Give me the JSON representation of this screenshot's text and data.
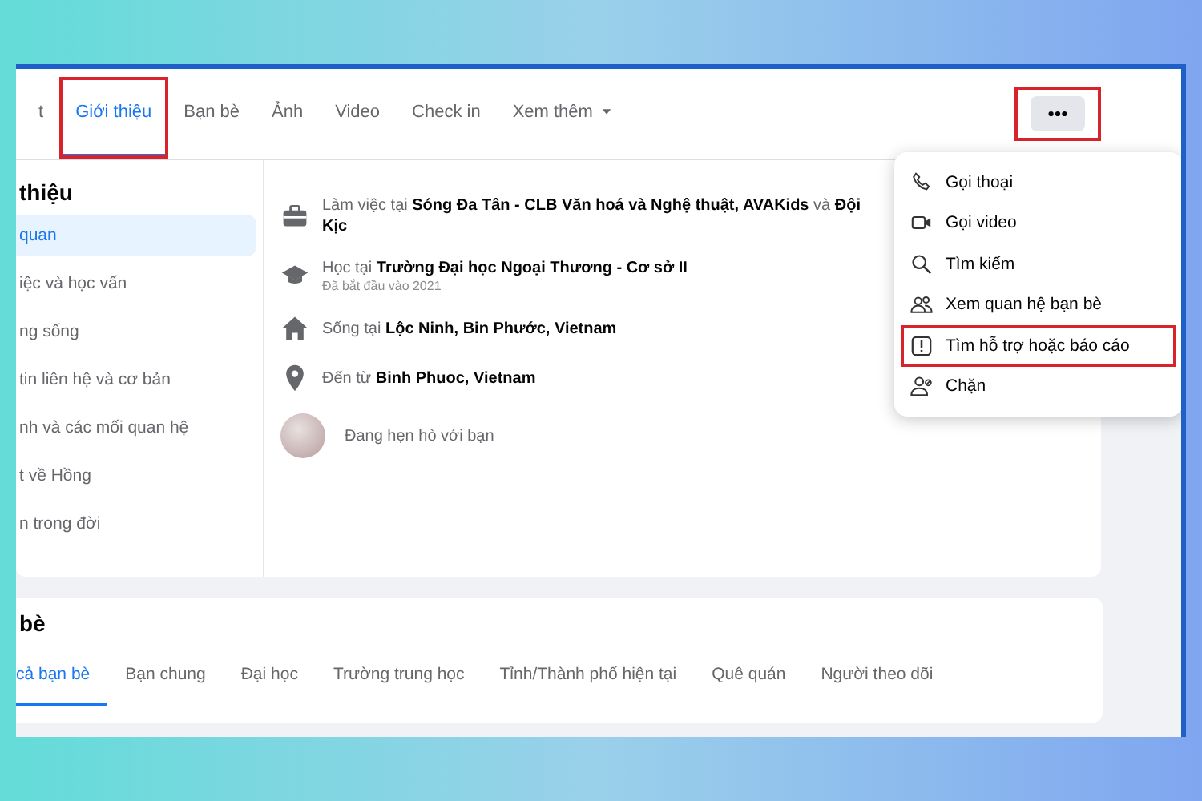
{
  "profile_tabs": [
    {
      "label": "t",
      "selected": false,
      "highlighted": false
    },
    {
      "label": "Giới thiệu",
      "selected": true,
      "highlighted": true
    },
    {
      "label": "Bạn bè",
      "selected": false,
      "highlighted": false
    },
    {
      "label": "Ảnh",
      "selected": false,
      "highlighted": false
    },
    {
      "label": "Video",
      "selected": false,
      "highlighted": false
    },
    {
      "label": "Check in",
      "selected": false,
      "highlighted": false
    },
    {
      "label": "Xem thêm",
      "selected": false,
      "highlighted": false,
      "dropdown": true
    }
  ],
  "more_button": {
    "highlighted": true
  },
  "about_sidebar": {
    "title": "thiệu",
    "items": [
      {
        "label": "quan",
        "selected": true
      },
      {
        "label": "iệc và học vấn",
        "selected": false
      },
      {
        "label": "ng sống",
        "selected": false
      },
      {
        "label": "tin liên hệ và cơ bản",
        "selected": false
      },
      {
        "label": "nh và các mối quan hệ",
        "selected": false
      },
      {
        "label": "t về Hồng",
        "selected": false
      },
      {
        "label": "n trong đời",
        "selected": false
      }
    ]
  },
  "about_details": [
    {
      "kind": "work",
      "text": "Làm việc tại **Sóng Đa Tân - CLB Văn hoá và Nghệ thuật, AVAKids** và **Đội Kịc**"
    },
    {
      "kind": "school",
      "text": "Học tại **Trường Đại học Ngoại Thương - Cơ sở II**",
      "note": "Đã bắt đầu vào 2021"
    },
    {
      "kind": "home",
      "text": "Sống tại **Lộc Ninh, Bin Phước, Vietnam**"
    },
    {
      "kind": "place",
      "text": "Đến từ **Binh Phuoc, Vietnam**"
    },
    {
      "kind": "relationship",
      "text": "Đang hẹn hò với bạn"
    }
  ],
  "more_menu": [
    {
      "kind": "call",
      "label": "Gọi thoại",
      "highlighted": false
    },
    {
      "kind": "video",
      "label": "Gọi video",
      "highlighted": false
    },
    {
      "kind": "search",
      "label": "Tìm kiếm",
      "highlighted": false
    },
    {
      "kind": "friends",
      "label": "Xem quan hệ bạn bè",
      "highlighted": false
    },
    {
      "kind": "report",
      "label": "Tìm hỗ trợ hoặc báo cáo",
      "highlighted": true
    },
    {
      "kind": "block",
      "label": "Chặn",
      "highlighted": false
    }
  ],
  "friends_section": {
    "title": "bè",
    "tabs": [
      {
        "label": "cả bạn bè",
        "selected": true
      },
      {
        "label": "Bạn chung",
        "selected": false
      },
      {
        "label": "Đại học",
        "selected": false
      },
      {
        "label": "Trường trung học",
        "selected": false
      },
      {
        "label": "Tỉnh/Thành phố hiện tại",
        "selected": false
      },
      {
        "label": "Quê quán",
        "selected": false
      },
      {
        "label": "Người theo dõi",
        "selected": false
      }
    ]
  }
}
